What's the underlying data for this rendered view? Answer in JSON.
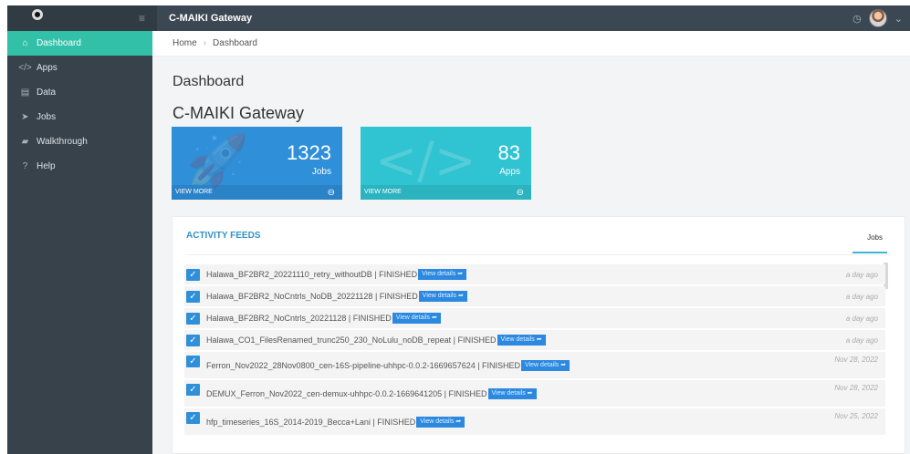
{
  "topbar": {
    "title": "C-MAIKI Gateway",
    "clock_icon": "clock-icon",
    "avatar_icon": "user-avatar-icon",
    "menu_icon": "hamburger-icon"
  },
  "sidebar": {
    "items": [
      {
        "label": "Dashboard",
        "icon": "home-icon",
        "active": true
      },
      {
        "label": "Apps",
        "icon": "code-icon",
        "active": false
      },
      {
        "label": "Data",
        "icon": "database-icon",
        "active": false
      },
      {
        "label": "Jobs",
        "icon": "paper-plane-icon",
        "active": false
      },
      {
        "label": "Walkthrough",
        "icon": "book-icon",
        "active": false
      },
      {
        "label": "Help",
        "icon": "help-icon",
        "active": false
      }
    ]
  },
  "breadcrumb": {
    "home": "Home",
    "current": "Dashboard"
  },
  "main": {
    "title": "Dashboard",
    "section": "C-MAIKI Gateway",
    "cards": [
      {
        "value": "1323",
        "label": "Jobs",
        "footer": "VIEW MORE",
        "icon": "rocket-icon"
      },
      {
        "value": "83",
        "label": "Apps",
        "footer": "VIEW MORE",
        "icon": "code-icon"
      }
    ]
  },
  "activity": {
    "title": "ACTIVITY FEEDS",
    "tab": "Jobs",
    "button_label": "View details ➦",
    "rows": [
      {
        "text": "Halawa_BF2BR2_20221110_retry_withoutDB | FINISHED",
        "time": "a day ago"
      },
      {
        "text": "Halawa_BF2BR2_NoCntrls_NoDB_20221128 | FINISHED",
        "time": "a day ago"
      },
      {
        "text": "Halawa_BF2BR2_NoCntrls_20221128 | FINISHED",
        "time": "a day ago"
      },
      {
        "text": "Halawa_CO1_FilesRenamed_trunc250_230_NoLulu_noDB_repeat | FINISHED",
        "time": "a day ago"
      },
      {
        "text": "Ferron_Nov2022_28Nov0800_cen-16S-pipeline-uhhpc-0.0.2-1669657624 | FINISHED",
        "time": "Nov 28, 2022"
      },
      {
        "text": "DEMUX_Ferron_Nov2022_cen-demux-uhhpc-0.0.2-1669641205 | FINISHED",
        "time": "Nov 28, 2022"
      },
      {
        "text": "hfp_timeseries_16S_2014-2019_Becca+Lani | FINISHED",
        "time": "Nov 25, 2022"
      }
    ]
  },
  "colors": {
    "sidebar": "#37424b",
    "active": "#33c0a8",
    "blue_card": "#2f8fd8",
    "cyan_card": "#30c3d1",
    "accent": "#2f93c8"
  }
}
